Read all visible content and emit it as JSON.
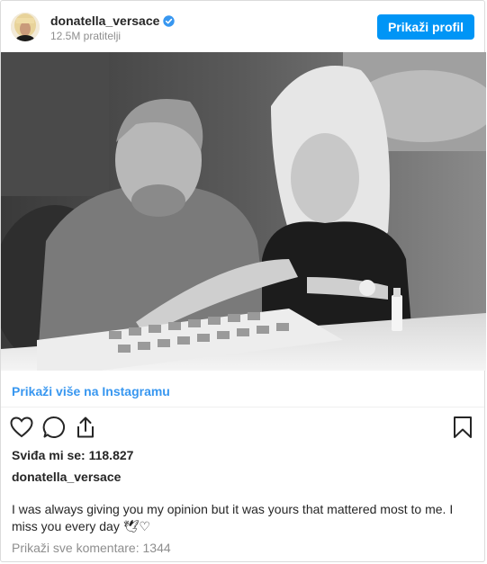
{
  "header": {
    "username": "donatella_versace",
    "followers": "12.5M pratitelji",
    "profile_button": "Prikaži profil",
    "verified_icon": "verified-badge-icon"
  },
  "post": {
    "more_link": "Prikaži više na Instagramu",
    "likes": "Sviđa mi se: 118.827",
    "caption_user": "donatella_versace",
    "caption_text": "I was always giving you my opinion but it was yours that mattered most to me. I miss you every day 🕊♡",
    "comments_link": "Prikaži sve komentare: 1344"
  },
  "icons": {
    "like": "heart-outline-icon",
    "comment": "comment-bubble-icon",
    "share": "share-arrow-icon",
    "save": "bookmark-icon"
  },
  "colors": {
    "accent": "#0095f6",
    "link": "#3897f0",
    "text": "#262626",
    "muted": "#8e8e8e",
    "border": "#dbdbdb"
  }
}
